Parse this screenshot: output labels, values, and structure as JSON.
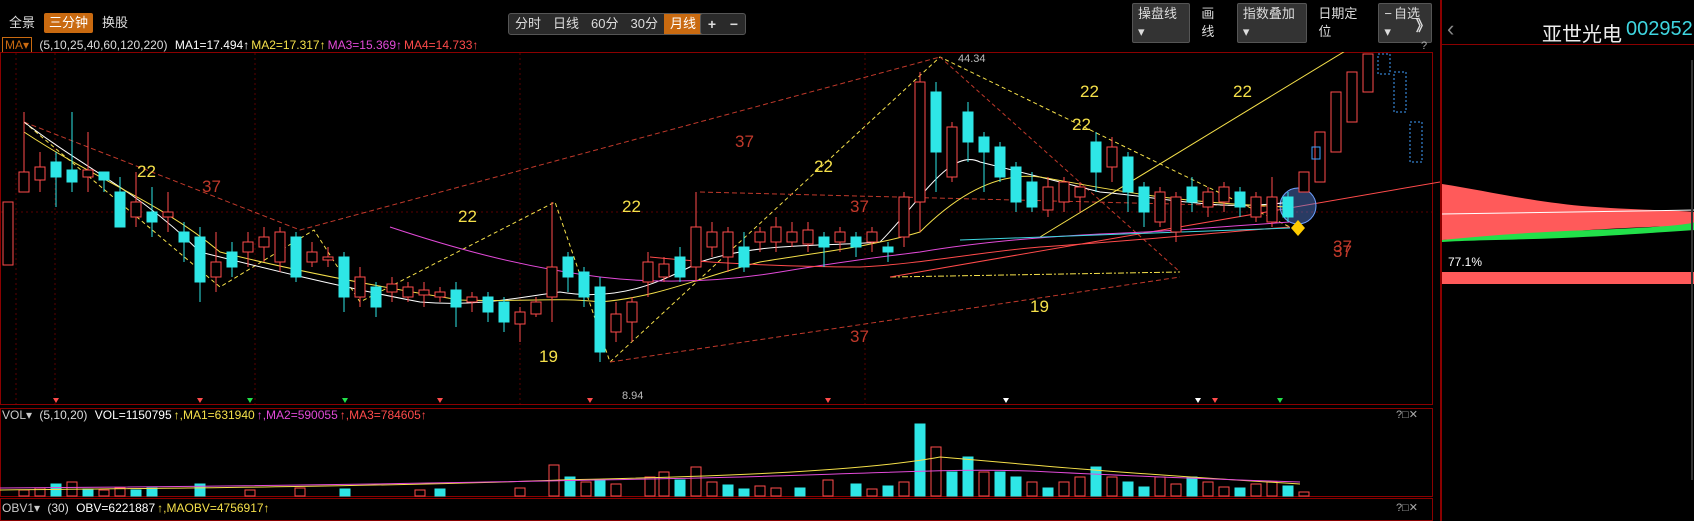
{
  "toolbar": {
    "left_buttons": [
      "全景",
      "三分钟",
      "换股"
    ],
    "active_left": 1,
    "periods": [
      "分时",
      "日线",
      "60分",
      "30分",
      "月线"
    ],
    "active_period": 4,
    "zoom_in": "+",
    "zoom_out": "−",
    "right_items": [
      "操盘线",
      "画线",
      "指数叠加",
      "日期定位",
      "自选"
    ],
    "collapse_label": "》"
  },
  "ma_indicator": {
    "label": "MA",
    "params": "(5,10,25,40,60,120,220)",
    "values": [
      {
        "text": "MA1=17.494↑",
        "color": "#ffffff"
      },
      {
        "text": "MA2=17.317↑",
        "color": "#f5e04a"
      },
      {
        "text": "MA3=15.369↑",
        "color": "#e24ad8"
      },
      {
        "text": "MA4=14.733↑",
        "color": "#ff4b4b"
      }
    ]
  },
  "vol_indicator": {
    "label": "VOL",
    "params": "(5,10,20)",
    "values": [
      {
        "text": "VOL=1150795",
        "color": "#ffffff"
      },
      {
        "text": "↑,MA1=631940",
        "color": "#f5e04a"
      },
      {
        "text": "↑,MA2=590055",
        "color": "#e24ad8"
      },
      {
        "text": "↑,MA3=784605↑",
        "color": "#ff4b4b"
      }
    ]
  },
  "obv_indicator": {
    "label": "OBV1",
    "params": "(30)",
    "values": [
      {
        "text": "OBV=6221887",
        "color": "#ffffff"
      },
      {
        "text": "↑,MAOBV=4756917↑",
        "color": "#f5e04a"
      }
    ]
  },
  "price_chart": {
    "high_label": "44.34",
    "low_label": "8.94",
    "fib_labels": [
      {
        "text": "22",
        "color": "#f5e04a"
      },
      {
        "text": "37",
        "color": "#c0392b"
      },
      {
        "text": "22",
        "color": "#f5e04a"
      },
      {
        "text": "22",
        "color": "#f5e04a"
      },
      {
        "text": "37",
        "color": "#c0392b"
      },
      {
        "text": "22",
        "color": "#f5e04a"
      },
      {
        "text": "19",
        "color": "#f5e04a"
      },
      {
        "text": "37",
        "color": "#c0392b"
      },
      {
        "text": "22",
        "color": "#f5e04a"
      },
      {
        "text": "37",
        "color": "#c0392b"
      },
      {
        "text": "37",
        "color": "#c0392b"
      },
      {
        "text": "22",
        "color": "#f5e04a"
      },
      {
        "text": "22",
        "color": "#f5e04a"
      },
      {
        "text": "19",
        "color": "#f5e04a"
      },
      {
        "text": "37",
        "color": "#c0392b"
      }
    ],
    "up_color": "#ff4b4b",
    "down_color": "#2ee6e6"
  },
  "right_panel": {
    "back_icon": "chevron-left-icon",
    "stock_name": "亚世光电",
    "stock_code": "002952",
    "percent_label": "77.1%"
  },
  "panel_controls": "?□✕"
}
